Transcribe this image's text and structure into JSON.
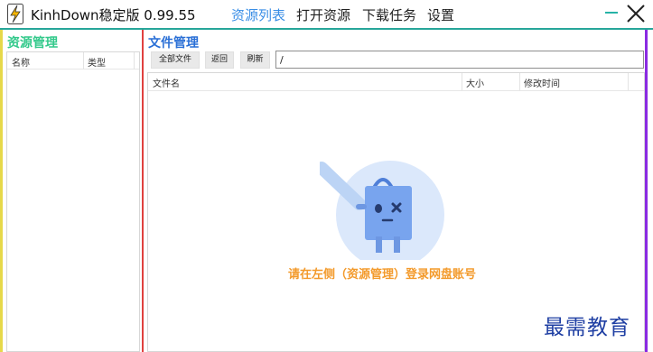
{
  "app": {
    "title": "KinhDown稳定版 0.99.55"
  },
  "nav": [
    {
      "label": "资源列表",
      "active": true
    },
    {
      "label": "打开资源",
      "active": false
    },
    {
      "label": "下载任务",
      "active": false
    },
    {
      "label": "设置",
      "active": false
    }
  ],
  "left_panel": {
    "title": "资源管理",
    "columns": [
      "名称",
      "类型"
    ]
  },
  "right_panel": {
    "title": "文件管理",
    "buttons": {
      "all_files": "全部文件",
      "back": "返回",
      "refresh": "刷新"
    },
    "path_value": "/",
    "columns": [
      "文件名",
      "大小",
      "修改时间"
    ],
    "empty_message": "请在左侧（资源管理）登录网盘账号"
  },
  "watermark": "最需教育",
  "colors": {
    "accent_teal": "#27a69a",
    "left_title": "#33c98b",
    "right_title": "#2a6fd6",
    "nav_active": "#3a8ee6",
    "empty_text": "#f39a2b",
    "divider_red": "#e0413f",
    "border_purple": "#8a2be2",
    "border_yellow": "#e6d84a"
  },
  "icons": {
    "app": "lightning-bolt-icon",
    "minimize": "minimize-icon",
    "close": "close-icon",
    "empty_state": "sad-bag-icon"
  }
}
